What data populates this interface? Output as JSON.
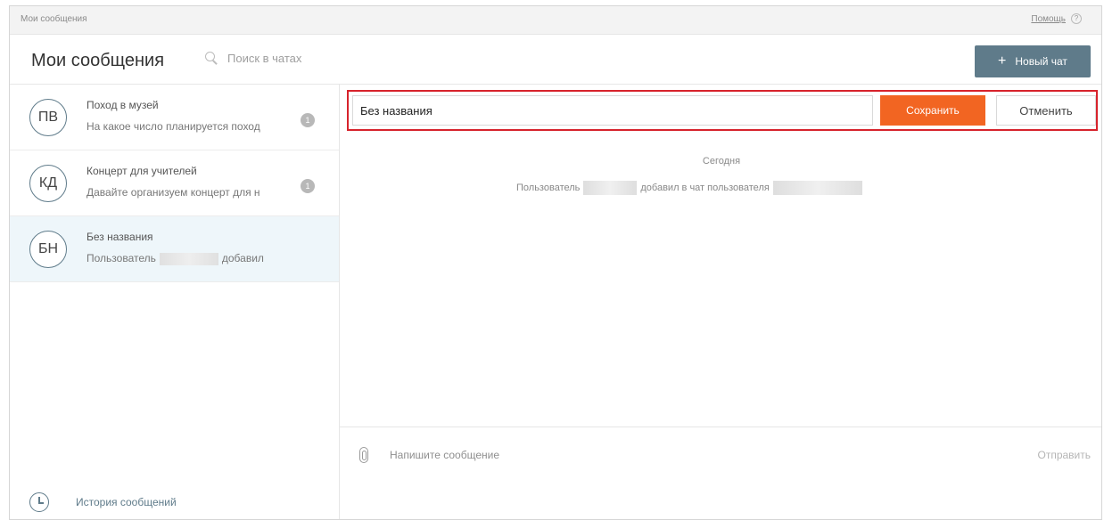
{
  "topbar": {
    "breadcrumb": "Мои сообщения",
    "help_label": "Помощь",
    "help_icon_glyph": "?"
  },
  "header": {
    "title": "Мои сообщения",
    "search_placeholder": "Поиск в чатах",
    "new_chat_icon": "+",
    "new_chat_label": "Новый чат"
  },
  "sidebar": {
    "chats": [
      {
        "initials": "ПВ",
        "name": "Поход в музей",
        "preview": "На какое число планируется поход",
        "unread": "1",
        "active": false
      },
      {
        "initials": "КД",
        "name": "Концерт для учителей",
        "preview": "Давайте организуем концерт для н",
        "unread": "1",
        "active": false
      },
      {
        "initials": "БН",
        "name": "Без названия",
        "preview_start": "Пользователь",
        "preview_end": "добавил",
        "active": true
      }
    ],
    "history_label": "История сообщений"
  },
  "main": {
    "rename": {
      "value": "Без названия",
      "save_label": "Сохранить",
      "cancel_label": "Отменить",
      "highlight_color": "#d7232c"
    },
    "day_label": "Сегодня",
    "system_message": {
      "part1": "Пользователь",
      "part2": "добавил в чат пользователя"
    },
    "composer": {
      "placeholder": "Напишите сообщение",
      "send_label": "Отправить"
    }
  },
  "colors": {
    "accent": "#5f7b8a",
    "save": "#f26522",
    "active_row": "#eef6fa"
  }
}
